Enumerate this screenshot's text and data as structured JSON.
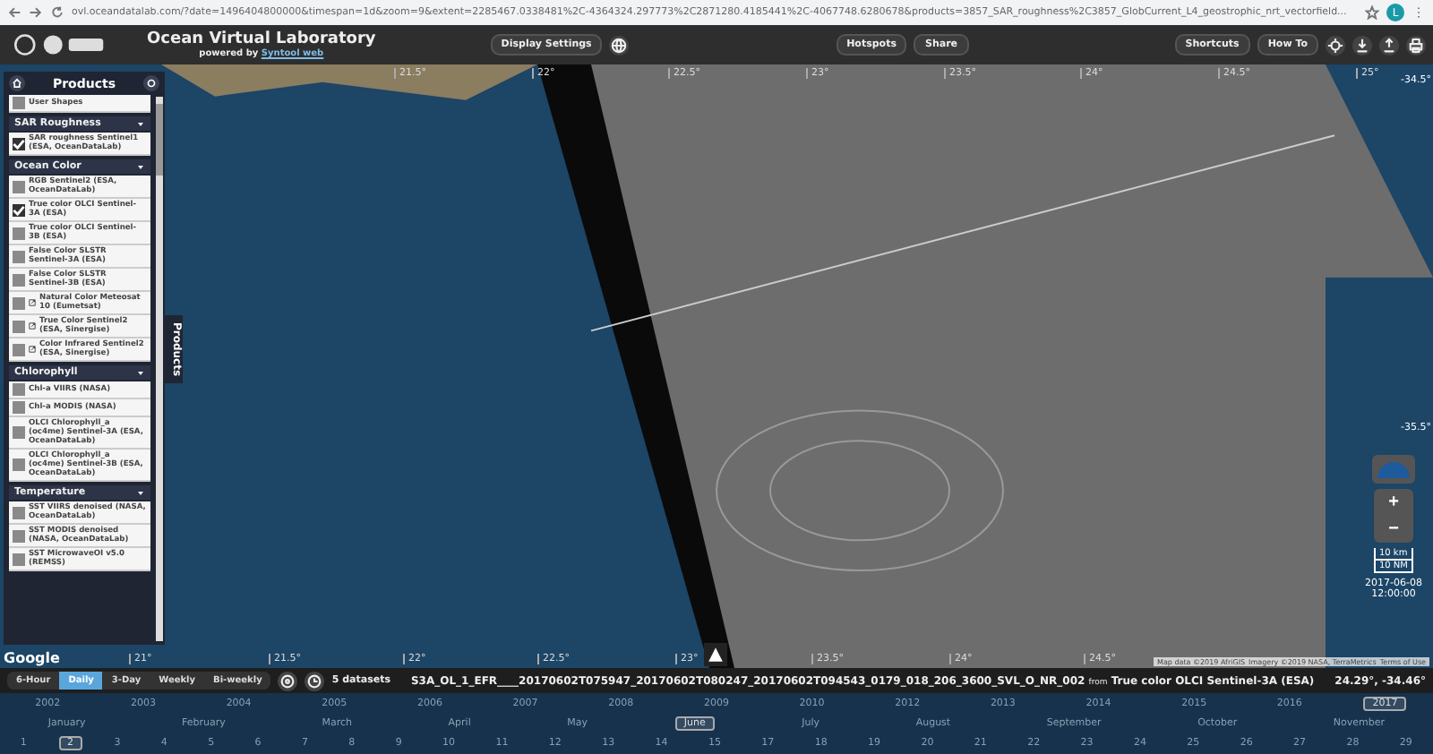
{
  "browser": {
    "url": "ovl.oceandatalab.com/?date=1496404800000&timespan=1d&zoom=9&extent=2285467.0338481%2C-4364324.297773%2C2871280.4185441%2C-4067748.6280678&products=3857_SAR_roughness%2C3857_GlobCurrent_L4_geostrophic_nrt_vectorfield...",
    "avatar": "L"
  },
  "header": {
    "title": "Ocean Virtual Laboratory",
    "subtitle": "powered by",
    "subtitle_link": "Syntool web",
    "display_settings": "Display Settings",
    "center_buttons": [
      "Hotspots",
      "Share"
    ],
    "right_buttons": [
      "Shortcuts",
      "How To"
    ]
  },
  "sidebar": {
    "title": "Products",
    "tab_label": "Products",
    "groups": [
      {
        "items": [
          {
            "label": "User Shapes",
            "checked": false,
            "external": false
          }
        ]
      },
      {
        "title": "SAR Roughness",
        "items": [
          {
            "label": "SAR roughness Sentinel1 (ESA, OceanDataLab)",
            "checked": true,
            "external": false
          }
        ]
      },
      {
        "title": "Ocean Color",
        "items": [
          {
            "label": "RGB Sentinel2 (ESA, OceanDataLab)",
            "checked": false,
            "external": false
          },
          {
            "label": "True color OLCI Sentinel-3A (ESA)",
            "checked": true,
            "external": false
          },
          {
            "label": "True color OLCI Sentinel-3B (ESA)",
            "checked": false,
            "external": false
          },
          {
            "label": "False Color SLSTR Sentinel-3A (ESA)",
            "checked": false,
            "external": false
          },
          {
            "label": "False Color SLSTR Sentinel-3B (ESA)",
            "checked": false,
            "external": false
          },
          {
            "label": "Natural Color Meteosat 10 (Eumetsat)",
            "checked": false,
            "external": true
          },
          {
            "label": "True Color Sentinel2 (ESA, Sinergise)",
            "checked": false,
            "external": true
          },
          {
            "label": "Color Infrared Sentinel2 (ESA, Sinergise)",
            "checked": false,
            "external": true
          }
        ]
      },
      {
        "title": "Chlorophyll",
        "items": [
          {
            "label": "Chl-a VIIRS (NASA)",
            "checked": false,
            "external": false
          },
          {
            "label": "Chl-a MODIS (NASA)",
            "checked": false,
            "external": false
          },
          {
            "label": "OLCI Chlorophyll_a (oc4me) Sentinel-3A (ESA, OceanDataLab)",
            "checked": false,
            "external": false
          },
          {
            "label": "OLCI Chlorophyll_a (oc4me) Sentinel-3B (ESA, OceanDataLab)",
            "checked": false,
            "external": false
          }
        ]
      },
      {
        "title": "Temperature",
        "items": [
          {
            "label": "SST VIIRS denoised (NASA, OceanDataLab)",
            "checked": false,
            "external": false
          },
          {
            "label": "SST MODIS denoised (NASA, OceanDataLab)",
            "checked": false,
            "external": false
          },
          {
            "label": "SST MicrowaveOI v5.0 (REMSS)",
            "checked": false,
            "external": false
          }
        ]
      }
    ]
  },
  "map": {
    "zoom_in": "+",
    "zoom_out": "−",
    "top_ticks": [
      "21.5°",
      "22°",
      "22.5°",
      "23°",
      "23.5°",
      "24°",
      "24.5°",
      "25°"
    ],
    "bottom_ticks": [
      "21°",
      "21.5°",
      "22°",
      "22.5°",
      "23°",
      "23.5°",
      "24°",
      "24.5°"
    ],
    "lat_ticks": [
      "-34.5°",
      "-35.5°"
    ],
    "scale_km": "10 km",
    "scale_nm": "10 NM",
    "date": "2017-06-08",
    "time": "12:00:00",
    "google": "Google",
    "attribution": [
      "Map data ©2019 AfriGIS",
      "Imagery ©2019 NASA, TerraMetrics",
      "Terms of Use"
    ]
  },
  "status_bar": {
    "spans": [
      {
        "label": "6-Hour",
        "selected": false
      },
      {
        "label": "Daily",
        "selected": true
      },
      {
        "label": "3-Day",
        "selected": false
      },
      {
        "label": "Weekly",
        "selected": false
      },
      {
        "label": "Bi-weekly",
        "selected": false
      }
    ],
    "datasets": "5 datasets",
    "granule": "S3A_OL_1_EFR____20170602T075947_20170602T080247_20170602T094543_0179_018_206_3600_SVL_O_NR_002",
    "from": "from",
    "product": "True color OLCI Sentinel-3A (ESA)",
    "coords": "24.29°, -34.46°"
  },
  "timeline": {
    "years": [
      {
        "label": "2002",
        "selected": false
      },
      {
        "label": "2003",
        "selected": false
      },
      {
        "label": "2004",
        "selected": false
      },
      {
        "label": "2005",
        "selected": false
      },
      {
        "label": "2006",
        "selected": false
      },
      {
        "label": "2007",
        "selected": false
      },
      {
        "label": "2008",
        "selected": false
      },
      {
        "label": "2009",
        "selected": false
      },
      {
        "label": "2010",
        "selected": false
      },
      {
        "label": "2012",
        "selected": false
      },
      {
        "label": "2013",
        "selected": false
      },
      {
        "label": "2014",
        "selected": false
      },
      {
        "label": "2015",
        "selected": false
      },
      {
        "label": "2016",
        "selected": false
      },
      {
        "label": "2017",
        "selected": true
      }
    ],
    "months": [
      {
        "label": "January",
        "selected": false
      },
      {
        "label": "February",
        "selected": false
      },
      {
        "label": "March",
        "selected": false
      },
      {
        "label": "April",
        "selected": false
      },
      {
        "label": "May",
        "selected": false
      },
      {
        "label": "June",
        "selected": true
      },
      {
        "label": "July",
        "selected": false
      },
      {
        "label": "August",
        "selected": false
      },
      {
        "label": "September",
        "selected": false
      },
      {
        "label": "October",
        "selected": false
      },
      {
        "label": "November",
        "selected": false
      }
    ],
    "days": [
      {
        "label": "1",
        "selected": false
      },
      {
        "label": "2",
        "selected": true
      },
      {
        "label": "3",
        "selected": false
      },
      {
        "label": "4",
        "selected": false
      },
      {
        "label": "5",
        "selected": false
      },
      {
        "label": "6",
        "selected": false
      },
      {
        "label": "7",
        "selected": false
      },
      {
        "label": "8",
        "selected": false
      },
      {
        "label": "9",
        "selected": false
      },
      {
        "label": "10",
        "selected": false
      },
      {
        "label": "11",
        "selected": false
      },
      {
        "label": "12",
        "selected": false
      },
      {
        "label": "13",
        "selected": false
      },
      {
        "label": "14",
        "selected": false
      },
      {
        "label": "15",
        "selected": false
      },
      {
        "label": "17",
        "selected": false
      },
      {
        "label": "18",
        "selected": false
      },
      {
        "label": "19",
        "selected": false
      },
      {
        "label": "20",
        "selected": false
      },
      {
        "label": "21",
        "selected": false
      },
      {
        "label": "22",
        "selected": false
      },
      {
        "label": "23",
        "selected": false
      },
      {
        "label": "24",
        "selected": false
      },
      {
        "label": "25",
        "selected": false
      },
      {
        "label": "26",
        "selected": false
      },
      {
        "label": "27",
        "selected": false
      },
      {
        "label": "28",
        "selected": false
      },
      {
        "label": "29",
        "selected": false
      }
    ]
  }
}
